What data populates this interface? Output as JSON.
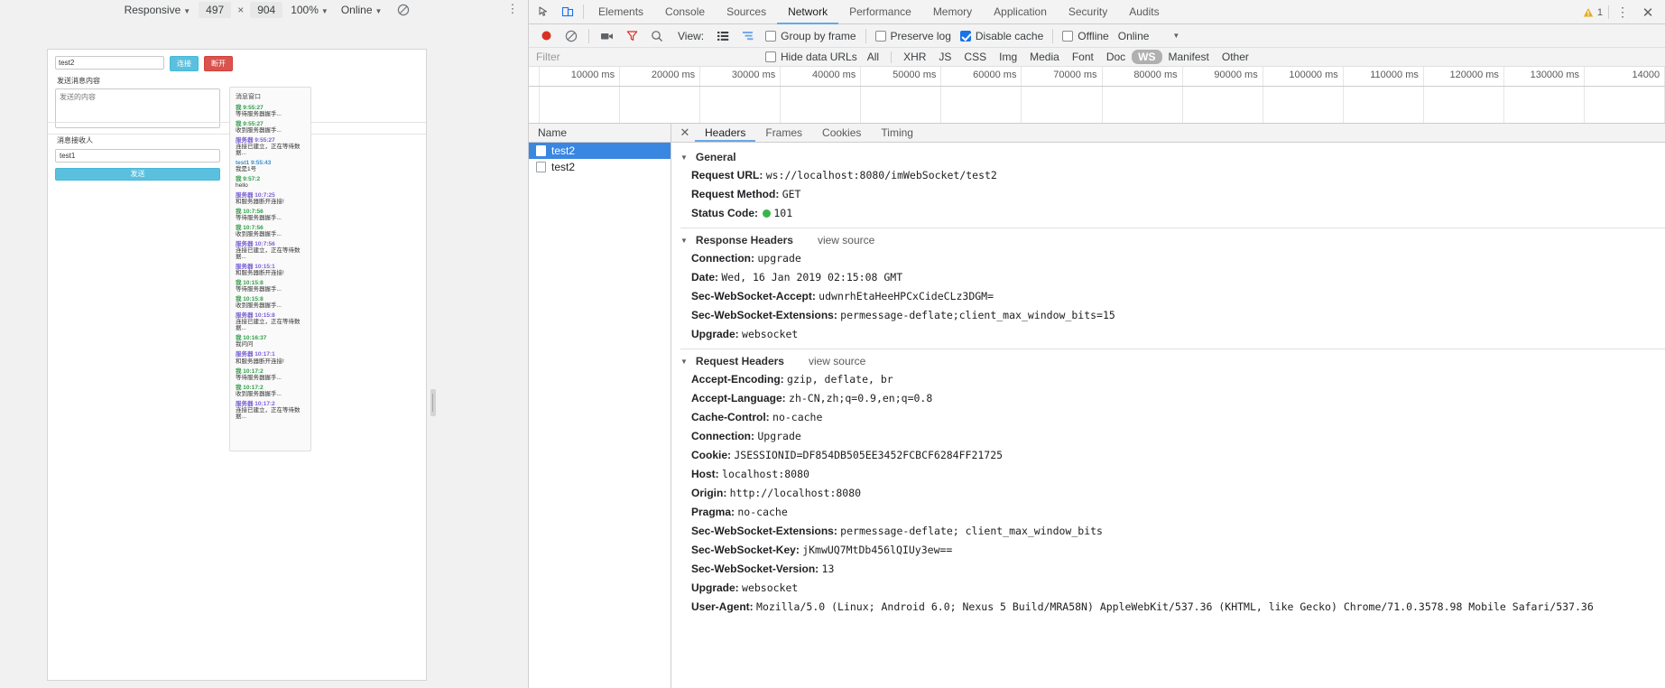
{
  "device_toolbar": {
    "device": "Responsive",
    "width": "497",
    "x_sep": "×",
    "height": "904",
    "zoom": "100%",
    "throttling": "Online",
    "rotate_icon": "rotate-icon",
    "kebab_icon": "more-options-icon"
  },
  "page": {
    "url_value": "test2",
    "btn_connect": "连接",
    "btn_disconnect": "断开",
    "label_send": "发送消息内容",
    "textarea_placeholder": "发送的内容",
    "label_receiver": "消息接收人",
    "receiver_value": "test1",
    "btn_send": "发送",
    "msg_panel_title": "消息窗口",
    "messages": [
      {
        "from": "我",
        "time": "9:55:27",
        "kind": "me",
        "text": "等待服务器握手..."
      },
      {
        "from": "我",
        "time": "9:55:27",
        "kind": "me",
        "text": "收到服务器握手..."
      },
      {
        "from": "服务器",
        "time": "9:55:27",
        "kind": "srv",
        "text": "连接已建立，正在等待数据..."
      },
      {
        "from": "test1",
        "time": "9:55:43",
        "kind": "peer",
        "text": "我是1号"
      },
      {
        "from": "我",
        "time": "9:57:2",
        "kind": "me",
        "text": "hello"
      },
      {
        "from": "服务器",
        "time": "10:7:25",
        "kind": "srv",
        "text": "和服务器断开连接!"
      },
      {
        "from": "我",
        "time": "10:7:56",
        "kind": "me",
        "text": "等待服务器握手..."
      },
      {
        "from": "我",
        "time": "10:7:56",
        "kind": "me",
        "text": "收到服务器握手..."
      },
      {
        "from": "服务器",
        "time": "10:7:56",
        "kind": "srv",
        "text": "连接已建立，正在等待数据..."
      },
      {
        "from": "服务器",
        "time": "10:15:1",
        "kind": "srv",
        "text": "和服务器断开连接!"
      },
      {
        "from": "我",
        "time": "10:15:8",
        "kind": "me",
        "text": "等待服务器握手..."
      },
      {
        "from": "我",
        "time": "10:15:8",
        "kind": "me",
        "text": "收到服务器握手..."
      },
      {
        "from": "服务器",
        "time": "10:15:8",
        "kind": "srv",
        "text": "连接已建立，正在等待数据..."
      },
      {
        "from": "我",
        "time": "10:16:37",
        "kind": "me",
        "text": "我问问"
      },
      {
        "from": "服务器",
        "time": "10:17:1",
        "kind": "srv",
        "text": "和服务器断开连接!"
      },
      {
        "from": "我",
        "time": "10:17:2",
        "kind": "me",
        "text": "等待服务器握手..."
      },
      {
        "from": "我",
        "time": "10:17:2",
        "kind": "me",
        "text": "收到服务器握手..."
      },
      {
        "from": "服务器",
        "time": "10:17:2",
        "kind": "srv",
        "text": "连接已建立，正在等待数据..."
      }
    ]
  },
  "devtools": {
    "inspect_icon": "inspect-element-icon",
    "device_icon": "toggle-device-toolbar-icon",
    "tabs": [
      {
        "label": "Elements",
        "active": false
      },
      {
        "label": "Console",
        "active": false
      },
      {
        "label": "Sources",
        "active": false
      },
      {
        "label": "Network",
        "active": true
      },
      {
        "label": "Performance",
        "active": false
      },
      {
        "label": "Memory",
        "active": false
      },
      {
        "label": "Application",
        "active": false
      },
      {
        "label": "Security",
        "active": false
      },
      {
        "label": "Audits",
        "active": false
      }
    ],
    "warning_count": "1",
    "warning_icon": "warning-triangle-icon",
    "settings_icon": "more-tools-icon",
    "close_icon": "close-devtools-icon",
    "network_toolbar": {
      "record_icon": "record-button-icon",
      "clear_icon": "clear-network-log-icon",
      "screenshot_icon": "capture-screenshots-icon",
      "filter_icon": "filter-icon",
      "search_icon": "search-icon",
      "view_label": "View:",
      "list_view_icon": "list-view-icon",
      "waterfall_view_icon": "waterfall-view-icon",
      "group_by_frame": {
        "label": "Group by frame",
        "checked": false
      },
      "preserve_log": {
        "label": "Preserve log",
        "checked": false
      },
      "disable_cache": {
        "label": "Disable cache",
        "checked": true
      },
      "offline": {
        "label": "Offline",
        "checked": false
      },
      "throttle_value": "Online"
    },
    "filter_bar": {
      "placeholder": "Filter",
      "hide_data_urls": {
        "label": "Hide data URLs",
        "checked": false
      },
      "types": [
        "All",
        "XHR",
        "JS",
        "CSS",
        "Img",
        "Media",
        "Font",
        "Doc",
        "WS",
        "Manifest",
        "Other"
      ],
      "selected_type": "WS"
    },
    "timeline_ticks": [
      "10000 ms",
      "20000 ms",
      "30000 ms",
      "40000 ms",
      "50000 ms",
      "60000 ms",
      "70000 ms",
      "80000 ms",
      "90000 ms",
      "100000 ms",
      "110000 ms",
      "120000 ms",
      "130000 ms",
      "14000"
    ],
    "request_list": {
      "column_header": "Name",
      "rows": [
        {
          "name": "test2",
          "selected": true
        },
        {
          "name": "test2",
          "selected": false
        }
      ]
    },
    "detail_tabs": [
      {
        "label": "Headers",
        "active": true
      },
      {
        "label": "Frames",
        "active": false
      },
      {
        "label": "Cookies",
        "active": false
      },
      {
        "label": "Timing",
        "active": false
      }
    ],
    "headers": {
      "sections": [
        {
          "title": "General",
          "view_source": "",
          "rows": [
            {
              "key": "Request URL:",
              "value": "ws://localhost:8080/imWebSocket/test2"
            },
            {
              "key": "Request Method:",
              "value": "GET"
            },
            {
              "key": "Status Code:",
              "value": "101",
              "status_dot": true
            }
          ]
        },
        {
          "title": "Response Headers",
          "view_source": "view source",
          "rows": [
            {
              "key": "Connection:",
              "value": "upgrade"
            },
            {
              "key": "Date:",
              "value": "Wed, 16 Jan 2019 02:15:08 GMT"
            },
            {
              "key": "Sec-WebSocket-Accept:",
              "value": "udwnrhEtaHeeHPCxCideCLz3DGM="
            },
            {
              "key": "Sec-WebSocket-Extensions:",
              "value": "permessage-deflate;client_max_window_bits=15"
            },
            {
              "key": "Upgrade:",
              "value": "websocket"
            }
          ]
        },
        {
          "title": "Request Headers",
          "view_source": "view source",
          "rows": [
            {
              "key": "Accept-Encoding:",
              "value": "gzip, deflate, br"
            },
            {
              "key": "Accept-Language:",
              "value": "zh-CN,zh;q=0.9,en;q=0.8"
            },
            {
              "key": "Cache-Control:",
              "value": "no-cache"
            },
            {
              "key": "Connection:",
              "value": "Upgrade"
            },
            {
              "key": "Cookie:",
              "value": "JSESSIONID=DF854DB505EE3452FCBCF6284FF21725"
            },
            {
              "key": "Host:",
              "value": "localhost:8080"
            },
            {
              "key": "Origin:",
              "value": "http://localhost:8080"
            },
            {
              "key": "Pragma:",
              "value": "no-cache"
            },
            {
              "key": "Sec-WebSocket-Extensions:",
              "value": "permessage-deflate; client_max_window_bits"
            },
            {
              "key": "Sec-WebSocket-Key:",
              "value": "jKmwUQ7MtDb456lQIUy3ew=="
            },
            {
              "key": "Sec-WebSocket-Version:",
              "value": "13"
            },
            {
              "key": "Upgrade:",
              "value": "websocket"
            },
            {
              "key": "User-Agent:",
              "value": "Mozilla/5.0 (Linux; Android 6.0; Nexus 5 Build/MRA58N) AppleWebKit/537.36 (KHTML, like Gecko) Chrome/71.0.3578.98 Mobile Safari/537.36"
            }
          ]
        }
      ]
    }
  }
}
